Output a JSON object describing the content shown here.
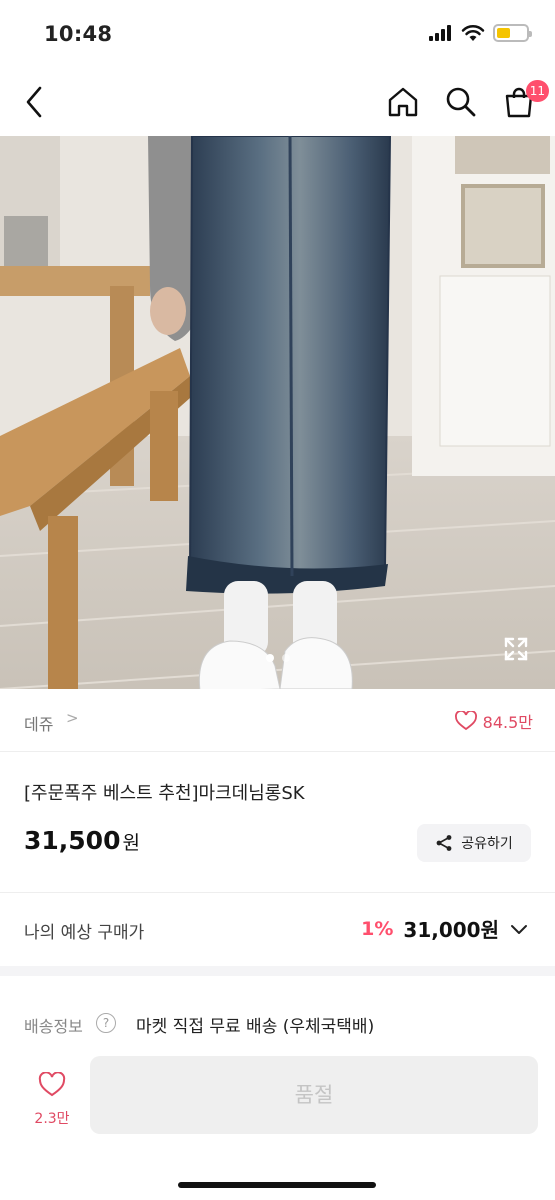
{
  "status": {
    "time": "10:48"
  },
  "header": {
    "cart_count": "11"
  },
  "product": {
    "shop_name": "데쥬",
    "shop_chevron": ">",
    "likes": "84.5만",
    "title": "[주문폭주 베스트 추천]마크데님롱SK",
    "price": "31,500",
    "price_unit": "원",
    "share_label": "공유하기"
  },
  "estimate": {
    "label": "나의 예상 구매가",
    "discount": "1%",
    "price": "31,000원"
  },
  "shipping": {
    "label": "배송정보",
    "help": "?",
    "value": "마켓 직접 무료 배송 (우체국택배)"
  },
  "bottom_bar": {
    "like_count": "2.3만",
    "sold_out_label": "품절"
  },
  "colors": {
    "accent": "#ff4f6d",
    "heart": "#e04a63"
  }
}
